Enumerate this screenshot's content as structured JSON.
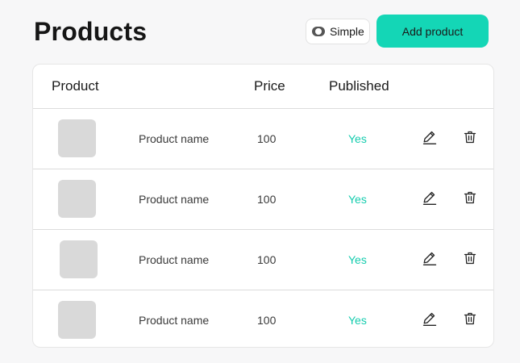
{
  "page": {
    "title": "Products"
  },
  "toolbar": {
    "toggle_label": "Simple",
    "add_label": "Add product"
  },
  "table": {
    "headers": {
      "product": "Product",
      "price": "Price",
      "published": "Published"
    },
    "rows": [
      {
        "name": "Product name",
        "price": "100",
        "published": "Yes"
      },
      {
        "name": "Product name",
        "price": "100",
        "published": "Yes"
      },
      {
        "name": "Product name",
        "price": "100",
        "published": "Yes"
      },
      {
        "name": "Product name",
        "price": "100",
        "published": "Yes"
      }
    ]
  },
  "icons": {
    "edit": "pencil-icon",
    "delete": "trash-icon"
  },
  "colors": {
    "accent": "#14d6b6",
    "published_yes": "#14ccae",
    "thumbnail_placeholder": "#d9d9d9"
  }
}
